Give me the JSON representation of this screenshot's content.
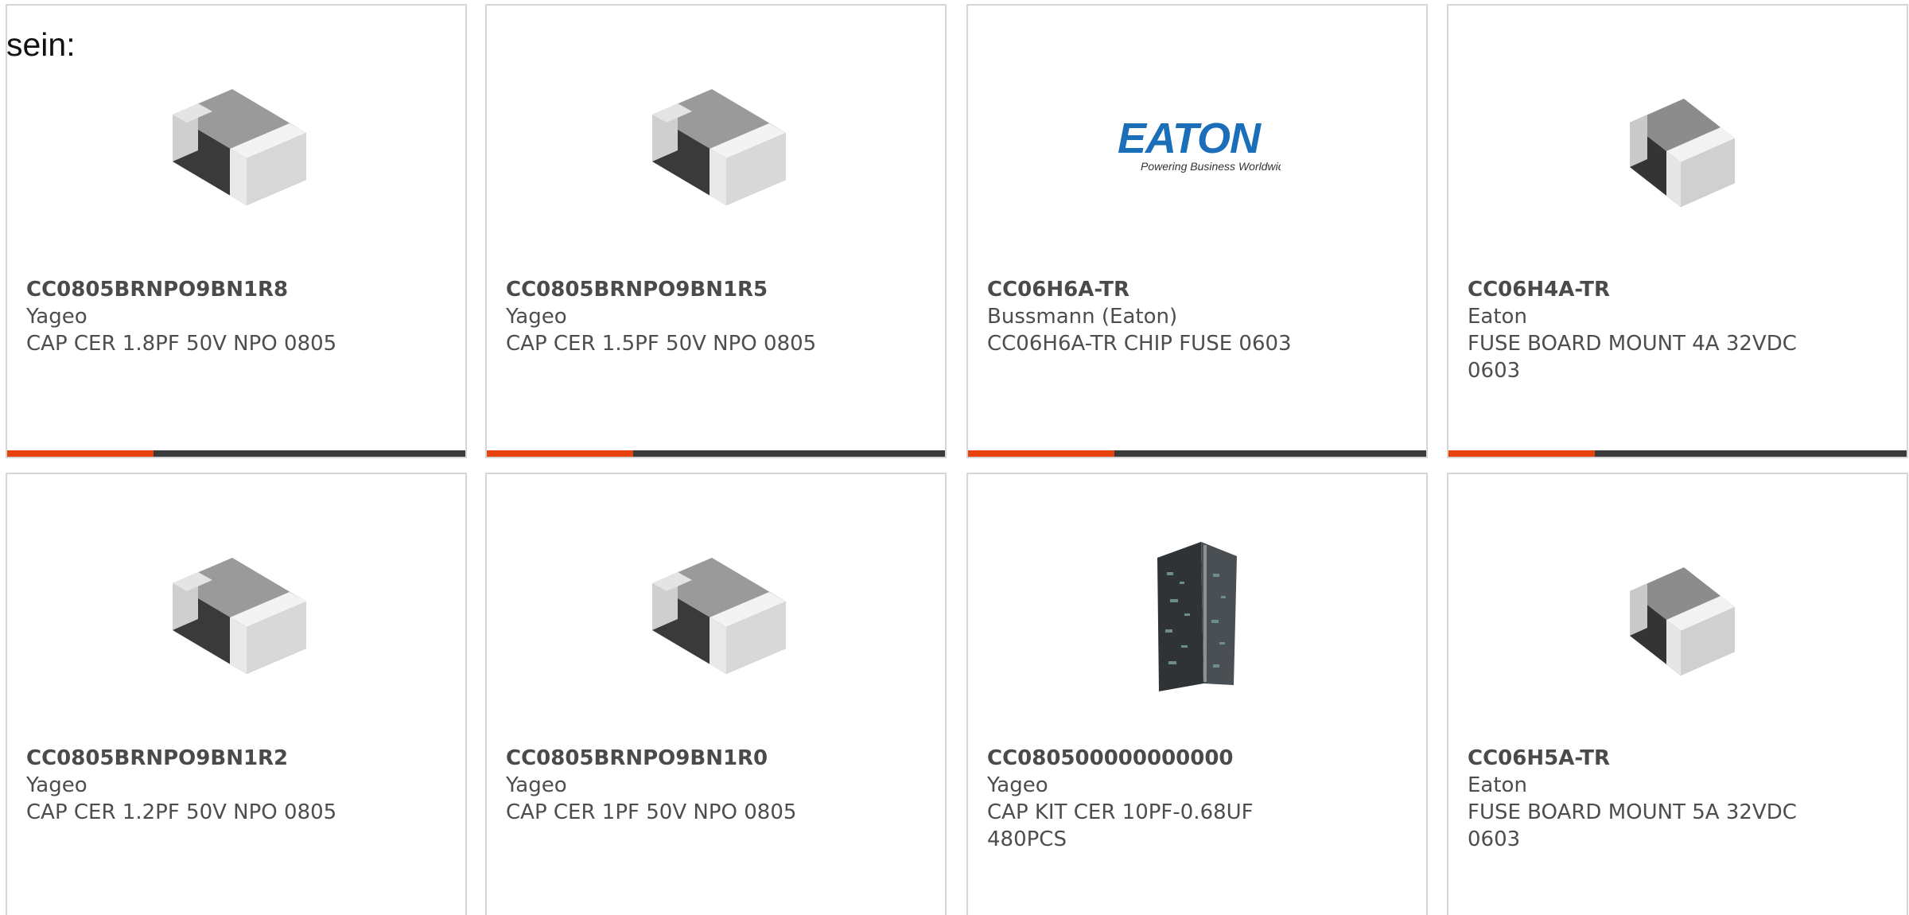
{
  "intro_text": "sein:",
  "brand_colors": {
    "accent": "#e8420f",
    "track": "#3b3b3b",
    "eaton_blue": "#1a6fb8"
  },
  "products": [
    {
      "part": "CC0805BRNPO9BN1R8",
      "manufacturer": "Yageo",
      "description": "CAP CER 1.8PF 50V NPO 0805",
      "image": "smd-capacitor-0805-image",
      "progress_fraction": 0.32
    },
    {
      "part": "CC0805BRNPO9BN1R5",
      "manufacturer": "Yageo",
      "description": "CAP CER 1.5PF 50V NPO 0805",
      "image": "smd-capacitor-0805-image",
      "progress_fraction": 0.32
    },
    {
      "part": "CC06H6A-TR",
      "manufacturer": "Bussmann (Eaton)",
      "description": "CC06H6A-TR CHIP FUSE 0603",
      "image": "eaton-logo",
      "logo_text": "EATON",
      "logo_tagline": "Powering Business Worldwide",
      "progress_fraction": 0.32
    },
    {
      "part": "CC06H4A-TR",
      "manufacturer": "Eaton",
      "description": "FUSE BOARD MOUNT 4A 32VDC 0603",
      "image": "chip-fuse-0603-image",
      "progress_fraction": 0.32
    },
    {
      "part": "CC0805BRNPO9BN1R2",
      "manufacturer": "Yageo",
      "description": "CAP CER 1.2PF 50V NPO 0805",
      "image": "smd-capacitor-0805-image"
    },
    {
      "part": "CC0805BRNPO9BN1R0",
      "manufacturer": "Yageo",
      "description": "CAP CER 1PF 50V NPO 0805",
      "image": "smd-capacitor-0805-image"
    },
    {
      "part": "CC080500000000000",
      "manufacturer": "Yageo",
      "description": "CAP KIT CER 10PF-0.68UF 480PCS",
      "image": "capacitor-kit-book-image"
    },
    {
      "part": "CC06H5A-TR",
      "manufacturer": "Eaton",
      "description": "FUSE BOARD MOUNT 5A 32VDC 0603",
      "image": "chip-fuse-0603-image"
    }
  ]
}
